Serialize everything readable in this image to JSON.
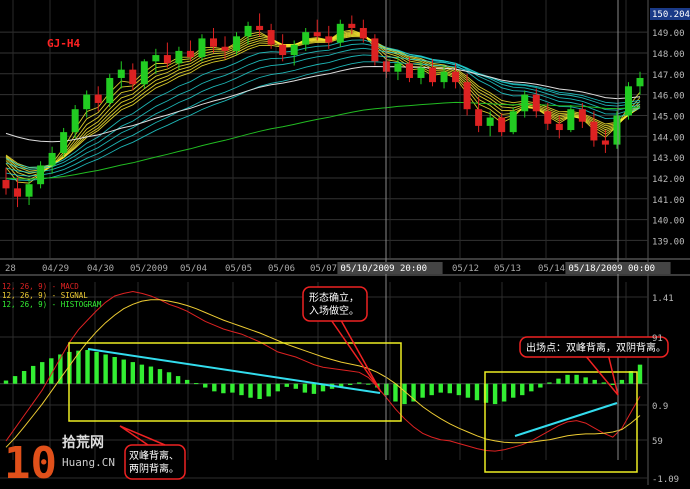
{
  "chart_data": [
    {
      "type": "candlestick",
      "title": "GJ-H4",
      "last_price_badge": "150.204",
      "y_ticks": [
        "149.00",
        "148.00",
        "147.00",
        "146.00",
        "145.00",
        "144.00",
        "143.00",
        "142.00",
        "141.00",
        "140.00",
        "139.00"
      ],
      "ylim": [
        138.3,
        150.4
      ],
      "x_ticks": [
        "28",
        "04/29",
        "04/30",
        "05/2009",
        "05/04",
        "05/05",
        "05/06",
        "05/07",
        "05/10/2009 20:00",
        "05/12",
        "05/13",
        "05/14",
        "05/18/2009 00:00"
      ],
      "grid": true,
      "colors": {
        "up": "#22cc22",
        "down": "#dd2222",
        "ma_fast": "#ffee33",
        "ma_mid": "#22d3d3",
        "ma_slow": "#dddddd",
        "ma_long": "#22bb22"
      },
      "candles": [
        [
          141.9,
          142.5,
          141.2,
          141.5
        ],
        [
          141.5,
          142.0,
          140.6,
          141.1
        ],
        [
          141.1,
          141.9,
          140.7,
          141.7
        ],
        [
          141.7,
          142.8,
          141.5,
          142.6
        ],
        [
          142.6,
          143.5,
          142.2,
          143.2
        ],
        [
          143.2,
          144.4,
          143.0,
          144.2
        ],
        [
          144.2,
          145.5,
          143.9,
          145.3
        ],
        [
          145.3,
          146.2,
          144.9,
          146.0
        ],
        [
          146.0,
          146.4,
          145.2,
          145.6
        ],
        [
          145.6,
          147.0,
          145.4,
          146.8
        ],
        [
          146.8,
          147.6,
          146.3,
          147.2
        ],
        [
          147.2,
          147.5,
          146.2,
          146.5
        ],
        [
          146.5,
          147.7,
          146.3,
          147.6
        ],
        [
          147.6,
          148.2,
          147.0,
          147.9
        ],
        [
          147.9,
          148.5,
          147.3,
          147.5
        ],
        [
          147.5,
          148.3,
          147.2,
          148.1
        ],
        [
          148.1,
          148.6,
          147.6,
          147.8
        ],
        [
          147.8,
          148.9,
          147.6,
          148.7
        ],
        [
          148.7,
          149.2,
          148.0,
          148.3
        ],
        [
          148.3,
          148.8,
          147.7,
          148.1
        ],
        [
          148.1,
          149.0,
          147.9,
          148.8
        ],
        [
          148.8,
          149.5,
          148.4,
          149.3
        ],
        [
          149.3,
          149.9,
          148.8,
          149.1
        ],
        [
          149.1,
          149.4,
          148.2,
          148.4
        ],
        [
          148.4,
          148.9,
          147.6,
          147.9
        ],
        [
          147.9,
          148.6,
          147.4,
          148.4
        ],
        [
          148.4,
          149.2,
          148.1,
          149.0
        ],
        [
          149.0,
          149.6,
          148.6,
          148.8
        ],
        [
          148.8,
          149.3,
          148.2,
          148.5
        ],
        [
          148.5,
          149.6,
          148.3,
          149.4
        ],
        [
          149.4,
          149.8,
          148.9,
          149.2
        ],
        [
          149.2,
          149.6,
          148.5,
          148.7
        ],
        [
          148.7,
          148.9,
          147.4,
          147.6
        ],
        [
          147.6,
          147.9,
          146.8,
          147.1
        ],
        [
          147.1,
          147.8,
          146.7,
          147.5
        ],
        [
          147.5,
          147.8,
          146.6,
          146.8
        ],
        [
          146.8,
          147.6,
          146.5,
          147.3
        ],
        [
          147.3,
          147.7,
          146.4,
          146.6
        ],
        [
          146.6,
          147.4,
          146.3,
          147.1
        ],
        [
          147.1,
          147.5,
          146.3,
          146.6
        ],
        [
          146.6,
          147.0,
          145.0,
          145.3
        ],
        [
          145.3,
          145.9,
          144.2,
          144.5
        ],
        [
          144.5,
          145.2,
          144.0,
          144.9
        ],
        [
          144.9,
          145.1,
          144.0,
          144.2
        ],
        [
          144.2,
          145.4,
          144.1,
          145.2
        ],
        [
          145.2,
          146.2,
          144.9,
          146.0
        ],
        [
          146.0,
          146.3,
          144.9,
          145.2
        ],
        [
          145.2,
          145.6,
          144.3,
          144.6
        ],
        [
          144.6,
          145.0,
          143.9,
          144.3
        ],
        [
          144.3,
          145.5,
          144.2,
          145.3
        ],
        [
          145.3,
          145.6,
          144.4,
          144.7
        ],
        [
          144.7,
          145.2,
          143.5,
          143.8
        ],
        [
          143.8,
          144.3,
          143.2,
          143.6
        ],
        [
          143.6,
          145.2,
          143.4,
          145.0
        ],
        [
          145.0,
          146.6,
          144.8,
          146.4
        ],
        [
          146.4,
          147.1,
          146.0,
          146.8
        ]
      ],
      "annotations": [
        {
          "text": "05/10/2009 20:00",
          "kind": "cursor"
        },
        {
          "text": "05/18/2009 00:00",
          "kind": "cursor"
        }
      ]
    },
    {
      "type": "macd",
      "legend": [
        "12, 26, 9) - MACD",
        "12, 26, 9) - SIGNAL",
        "12, 26, 9) - HISTOGRAM"
      ],
      "y_ticks": [
        "1.41",
        "91",
        "0.9",
        "59",
        "-1.09"
      ],
      "ylim": [
        -1.2,
        1.6
      ],
      "histogram": [
        0.05,
        0.12,
        0.2,
        0.28,
        0.34,
        0.4,
        0.46,
        0.5,
        0.52,
        0.53,
        0.5,
        0.46,
        0.42,
        0.38,
        0.34,
        0.3,
        0.27,
        0.23,
        0.18,
        0.12,
        0.06,
        0.01,
        -0.06,
        -0.12,
        -0.15,
        -0.14,
        -0.18,
        -0.22,
        -0.24,
        -0.2,
        -0.12,
        -0.05,
        -0.08,
        -0.14,
        -0.16,
        -0.12,
        -0.08,
        -0.05,
        -0.02,
        0.02,
        0.0,
        -0.06,
        -0.18,
        -0.28,
        -0.32,
        -0.28,
        -0.22,
        -0.18,
        -0.14,
        -0.15,
        -0.18,
        -0.22,
        -0.26,
        -0.3,
        -0.32,
        -0.28,
        -0.22,
        -0.18,
        -0.12,
        -0.06,
        0.02,
        0.08,
        0.14,
        0.14,
        0.1,
        0.06,
        0.02,
        -0.02,
        0.06,
        0.2,
        0.3
      ],
      "macd": [
        -0.9,
        -0.7,
        -0.5,
        -0.3,
        -0.1,
        0.15,
        0.4,
        0.65,
        0.85,
        1.0,
        1.15,
        1.28,
        1.38,
        1.42,
        1.45,
        1.42,
        1.38,
        1.32,
        1.25,
        1.2,
        1.14,
        1.06,
        0.98,
        0.92,
        0.86,
        0.82,
        0.78,
        0.72,
        0.66,
        0.58,
        0.5,
        0.46,
        0.42,
        0.36,
        0.3,
        0.26,
        0.24,
        0.22,
        0.2,
        0.18,
        0.1,
        -0.05,
        -0.22,
        -0.4,
        -0.55,
        -0.68,
        -0.78,
        -0.84,
        -0.88,
        -0.9,
        -0.94,
        -0.98,
        -1.02,
        -1.05,
        -1.06,
        -1.04,
        -1.0,
        -0.96,
        -0.9,
        -0.82,
        -0.74,
        -0.66,
        -0.6,
        -0.58,
        -0.62,
        -0.7,
        -0.78,
        -0.84,
        -0.7,
        -0.45,
        -0.2
      ],
      "signal": [
        -1.0,
        -0.85,
        -0.68,
        -0.5,
        -0.32,
        -0.12,
        0.08,
        0.28,
        0.48,
        0.66,
        0.82,
        0.96,
        1.08,
        1.18,
        1.25,
        1.3,
        1.32,
        1.32,
        1.3,
        1.27,
        1.23,
        1.18,
        1.12,
        1.06,
        1.0,
        0.95,
        0.9,
        0.85,
        0.8,
        0.74,
        0.68,
        0.62,
        0.57,
        0.52,
        0.47,
        0.42,
        0.38,
        0.34,
        0.31,
        0.28,
        0.24,
        0.18,
        0.1,
        0.0,
        -0.12,
        -0.24,
        -0.36,
        -0.46,
        -0.55,
        -0.63,
        -0.7,
        -0.76,
        -0.82,
        -0.87,
        -0.9,
        -0.92,
        -0.93,
        -0.93,
        -0.92,
        -0.9,
        -0.88,
        -0.85,
        -0.82,
        -0.8,
        -0.79,
        -0.79,
        -0.78,
        -0.76,
        -0.72,
        -0.62,
        -0.5
      ],
      "annotations": [
        {
          "text_lines": [
            "形态确立，",
            "入场做空。"
          ],
          "kind": "callout"
        },
        {
          "text_lines": [
            "出场点：双峰背离，双阴背离。"
          ],
          "kind": "callout"
        },
        {
          "text_lines": [
            "双峰背离、",
            "两阴背离。"
          ],
          "kind": "callout"
        }
      ]
    }
  ],
  "watermark": {
    "number": "10",
    "brand": "拾荒网",
    "site": "Huang.CN"
  }
}
